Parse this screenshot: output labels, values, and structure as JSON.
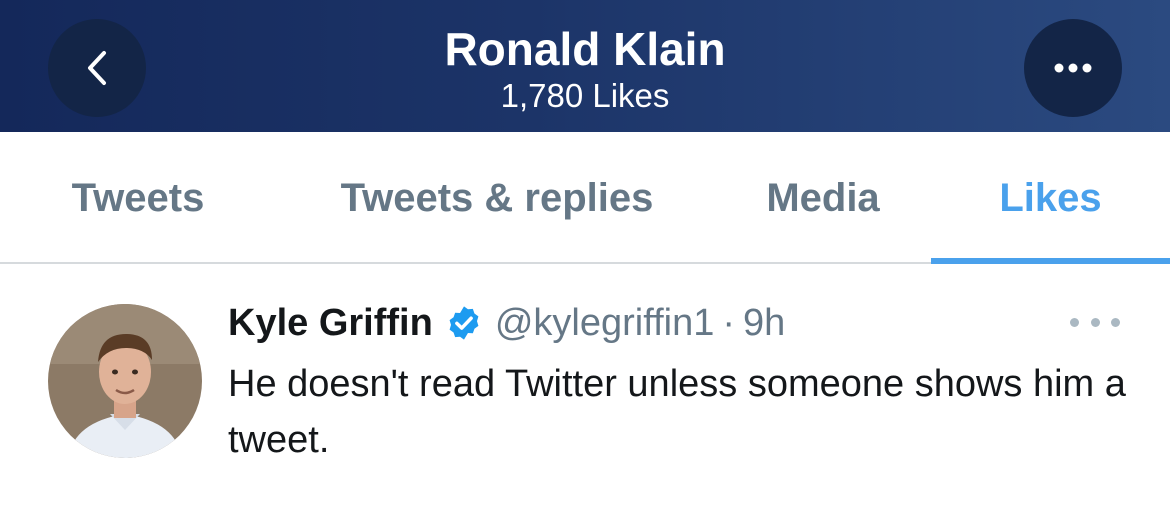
{
  "header": {
    "title": "Ronald Klain",
    "subtitle": "1,780 Likes",
    "back_icon": "chevron-left-icon",
    "more_icon": "more-horizontal-icon"
  },
  "tabs": [
    {
      "label": "Tweets",
      "active": false
    },
    {
      "label": "Tweets & replies",
      "active": false
    },
    {
      "label": "Media",
      "active": false
    },
    {
      "label": "Likes",
      "active": true
    }
  ],
  "tweet": {
    "author_name": "Kyle Griffin",
    "verified": true,
    "handle": "@kylegriffin1",
    "separator": "·",
    "time": "9h",
    "text": "He doesn't read Twitter unless someone shows him a tweet."
  },
  "colors": {
    "header_bg": "#1c3468",
    "accent": "#4aa1ec",
    "muted": "#657786"
  }
}
